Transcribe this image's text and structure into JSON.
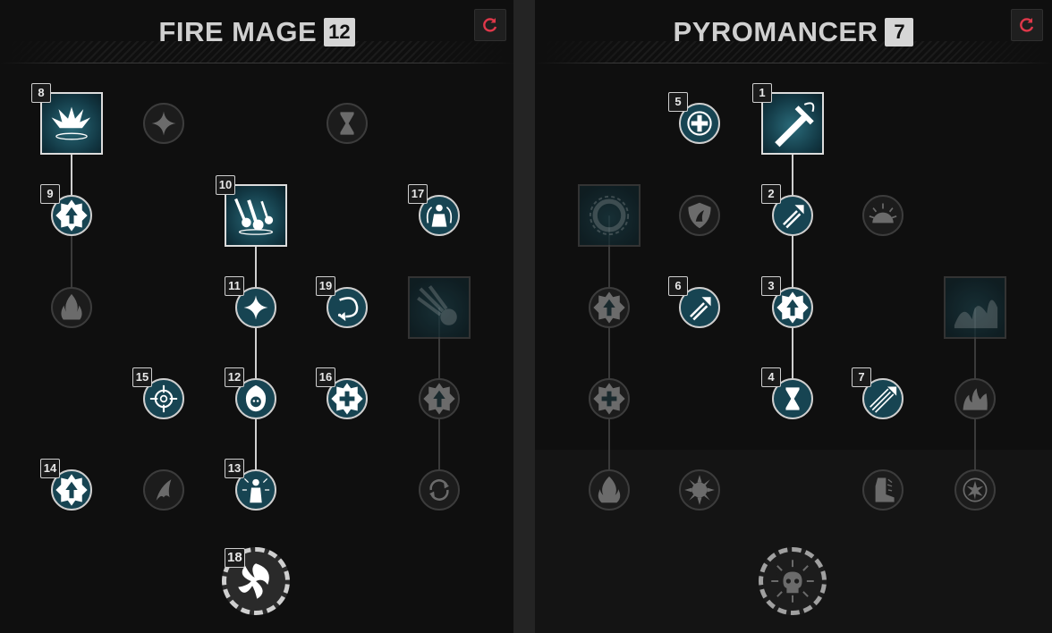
{
  "colors": {
    "active_node": "#174452",
    "active_border": "#cfcfcf",
    "inactive_border": "#3c3c3c",
    "reset_icon": "#e0384a"
  },
  "trees": [
    {
      "title": "FIRE MAGE",
      "points": "12",
      "reset_icon": "reset-icon",
      "nodes": [
        {
          "id": "a1",
          "shape": "square",
          "active": true,
          "rank": "8",
          "icon": "fire-burst-icon"
        },
        {
          "id": "a2",
          "shape": "circle",
          "active": false,
          "rank": "",
          "icon": "sparkle-icon"
        },
        {
          "id": "a3",
          "shape": "circle",
          "active": false,
          "rank": "",
          "icon": "hourglass-icon"
        },
        {
          "id": "a4",
          "shape": "circle",
          "active": true,
          "rank": "9",
          "icon": "arrow-up-badge-icon"
        },
        {
          "id": "a5",
          "shape": "square",
          "active": true,
          "rank": "10",
          "icon": "meteor-shower-icon"
        },
        {
          "id": "a6",
          "shape": "circle",
          "active": true,
          "rank": "17",
          "icon": "burning-figure-icon"
        },
        {
          "id": "a7",
          "shape": "circle",
          "active": false,
          "rank": "",
          "icon": "flame-icon"
        },
        {
          "id": "a8",
          "shape": "circle",
          "active": true,
          "rank": "11",
          "icon": "sparkle-icon"
        },
        {
          "id": "a9",
          "shape": "circle",
          "active": true,
          "rank": "19",
          "icon": "spiral-arrow-icon"
        },
        {
          "id": "a10",
          "shape": "square",
          "active": false,
          "rank": "",
          "icon": "comet-icon"
        },
        {
          "id": "a11",
          "shape": "circle",
          "active": true,
          "rank": "15",
          "icon": "crosshair-icon"
        },
        {
          "id": "a12",
          "shape": "circle",
          "active": true,
          "rank": "12",
          "icon": "flaming-skull-icon"
        },
        {
          "id": "a13",
          "shape": "circle",
          "active": true,
          "rank": "16",
          "icon": "health-cross-badge-icon"
        },
        {
          "id": "a14",
          "shape": "circle",
          "active": false,
          "rank": "",
          "icon": "arrow-up-badge-icon"
        },
        {
          "id": "a15",
          "shape": "circle",
          "active": true,
          "rank": "14",
          "icon": "arrow-up-badge-icon"
        },
        {
          "id": "a16",
          "shape": "circle",
          "active": false,
          "rank": "",
          "icon": "fire-dash-icon"
        },
        {
          "id": "a17",
          "shape": "circle",
          "active": true,
          "rank": "13",
          "icon": "radiant-figure-icon"
        },
        {
          "id": "a18",
          "shape": "circle",
          "active": false,
          "rank": "",
          "icon": "cycle-arrows-icon"
        },
        {
          "id": "a19",
          "shape": "ultimate",
          "active": true,
          "rank": "18",
          "icon": "fire-vortex-icon"
        }
      ]
    },
    {
      "title": "PYROMANCER",
      "points": "7",
      "reset_icon": "reset-icon",
      "nodes": [
        {
          "id": "b1",
          "shape": "circle",
          "active": true,
          "rank": "5",
          "icon": "health-cross-icon"
        },
        {
          "id": "b2",
          "shape": "square",
          "active": true,
          "rank": "1",
          "icon": "fire-sword-icon"
        },
        {
          "id": "b3",
          "shape": "square",
          "active": false,
          "rank": "",
          "icon": "fire-ring-icon"
        },
        {
          "id": "b4",
          "shape": "circle",
          "active": false,
          "rank": "",
          "icon": "fire-shield-icon"
        },
        {
          "id": "b5",
          "shape": "circle",
          "active": true,
          "rank": "2",
          "icon": "arrow-boost-icon"
        },
        {
          "id": "b6",
          "shape": "circle",
          "active": false,
          "rank": "",
          "icon": "sunrise-icon"
        },
        {
          "id": "b7",
          "shape": "circle",
          "active": false,
          "rank": "",
          "icon": "arrow-up-badge-icon"
        },
        {
          "id": "b8",
          "shape": "circle",
          "active": true,
          "rank": "6",
          "icon": "arrow-boost-icon"
        },
        {
          "id": "b9",
          "shape": "circle",
          "active": true,
          "rank": "3",
          "icon": "arrow-up-badge-icon"
        },
        {
          "id": "b10",
          "shape": "square",
          "active": false,
          "rank": "",
          "icon": "fire-trail-icon"
        },
        {
          "id": "b11",
          "shape": "circle",
          "active": false,
          "rank": "",
          "icon": "health-cross-badge-icon"
        },
        {
          "id": "b12",
          "shape": "circle",
          "active": true,
          "rank": "4",
          "icon": "hourglass-icon"
        },
        {
          "id": "b13",
          "shape": "circle",
          "active": true,
          "rank": "7",
          "icon": "triple-arrow-icon"
        },
        {
          "id": "b14",
          "shape": "circle",
          "active": false,
          "rank": "",
          "icon": "flames-icon"
        },
        {
          "id": "b15",
          "shape": "circle",
          "active": false,
          "rank": "",
          "icon": "fire-icon"
        },
        {
          "id": "b16",
          "shape": "circle",
          "active": false,
          "rank": "",
          "icon": "spiked-orb-icon"
        },
        {
          "id": "b17",
          "shape": "circle",
          "active": false,
          "rank": "",
          "icon": "fire-boot-icon"
        },
        {
          "id": "b18",
          "shape": "circle",
          "active": false,
          "rank": "",
          "icon": "fire-burst-badge-icon"
        },
        {
          "id": "b19",
          "shape": "ultimate",
          "active": false,
          "rank": "",
          "icon": "skull-explosion-icon"
        }
      ]
    }
  ]
}
